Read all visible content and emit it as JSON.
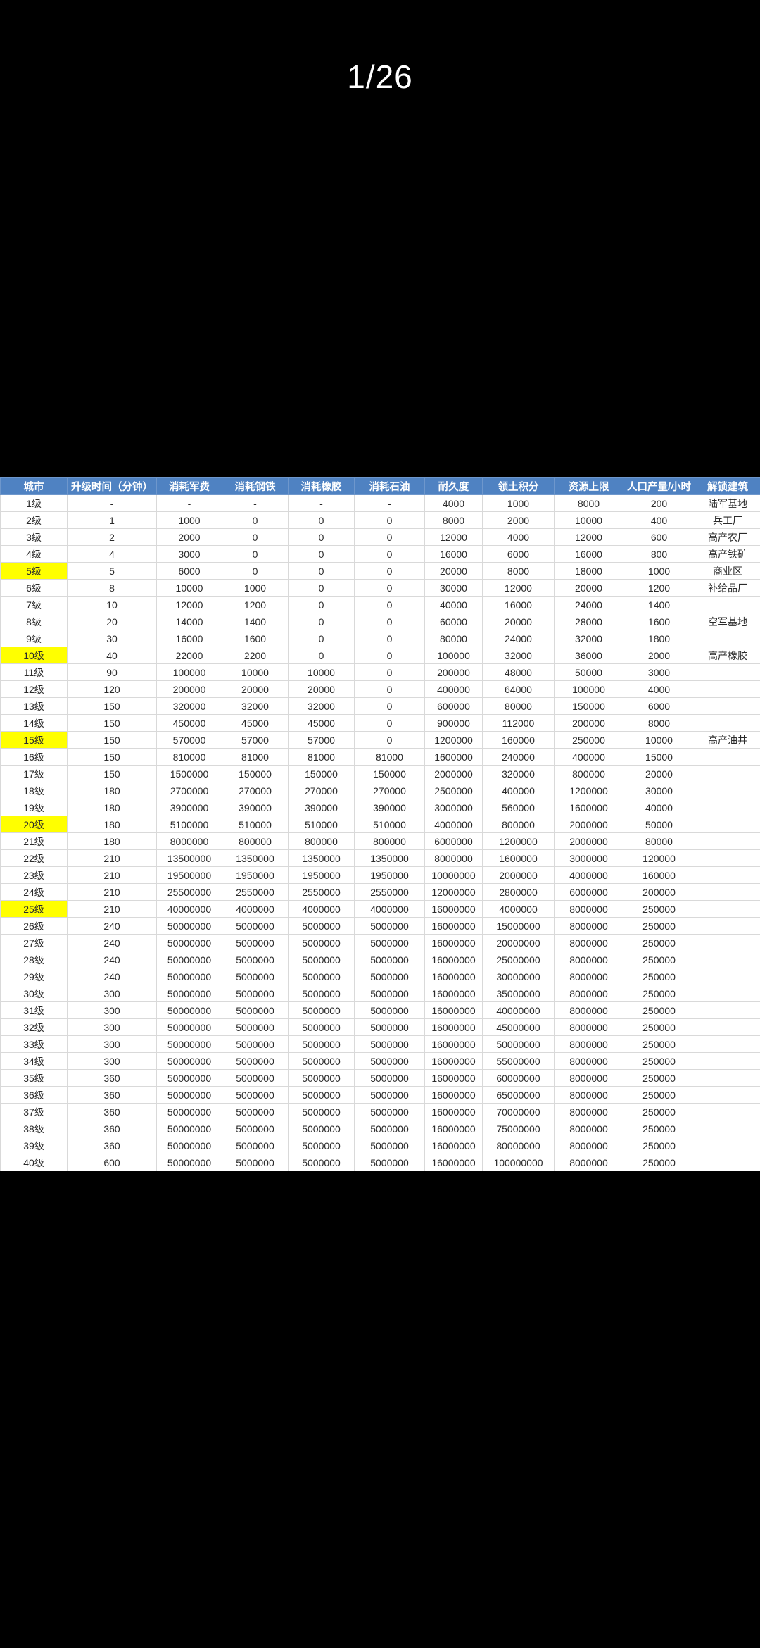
{
  "pager": {
    "label": "1/26"
  },
  "colors": {
    "screen_background": "#000000",
    "header_background": "#4f82c2",
    "header_text": "#ffffff",
    "highlight": "#ffff00",
    "cell_border": "#d9d9d9",
    "cell_text": "#2b2b2b"
  },
  "table": {
    "headers": [
      "城市",
      "升级时间（分钟）",
      "消耗军费",
      "消耗钢铁",
      "消耗橡胶",
      "消耗石油",
      "耐久度",
      "领土积分",
      "资源上限",
      "人口产量/小时",
      "解锁建筑"
    ],
    "highlight_levels": [
      "5级",
      "10级",
      "15级",
      "20级",
      "25级"
    ],
    "rows": [
      [
        "1级",
        "-",
        "-",
        "-",
        "-",
        "-",
        "4000",
        "1000",
        "8000",
        "200",
        "陆军基地"
      ],
      [
        "2级",
        "1",
        "1000",
        "0",
        "0",
        "0",
        "8000",
        "2000",
        "10000",
        "400",
        "兵工厂"
      ],
      [
        "3级",
        "2",
        "2000",
        "0",
        "0",
        "0",
        "12000",
        "4000",
        "12000",
        "600",
        "高产农厂"
      ],
      [
        "4级",
        "4",
        "3000",
        "0",
        "0",
        "0",
        "16000",
        "6000",
        "16000",
        "800",
        "高产铁矿"
      ],
      [
        "5级",
        "5",
        "6000",
        "0",
        "0",
        "0",
        "20000",
        "8000",
        "18000",
        "1000",
        "商业区"
      ],
      [
        "6级",
        "8",
        "10000",
        "1000",
        "0",
        "0",
        "30000",
        "12000",
        "20000",
        "1200",
        "补给品厂"
      ],
      [
        "7级",
        "10",
        "12000",
        "1200",
        "0",
        "0",
        "40000",
        "16000",
        "24000",
        "1400",
        ""
      ],
      [
        "8级",
        "20",
        "14000",
        "1400",
        "0",
        "0",
        "60000",
        "20000",
        "28000",
        "1600",
        "空军基地"
      ],
      [
        "9级",
        "30",
        "16000",
        "1600",
        "0",
        "0",
        "80000",
        "24000",
        "32000",
        "1800",
        ""
      ],
      [
        "10级",
        "40",
        "22000",
        "2200",
        "0",
        "0",
        "100000",
        "32000",
        "36000",
        "2000",
        "高产橡胶"
      ],
      [
        "11级",
        "90",
        "100000",
        "10000",
        "10000",
        "0",
        "200000",
        "48000",
        "50000",
        "3000",
        ""
      ],
      [
        "12级",
        "120",
        "200000",
        "20000",
        "20000",
        "0",
        "400000",
        "64000",
        "100000",
        "4000",
        ""
      ],
      [
        "13级",
        "150",
        "320000",
        "32000",
        "32000",
        "0",
        "600000",
        "80000",
        "150000",
        "6000",
        ""
      ],
      [
        "14级",
        "150",
        "450000",
        "45000",
        "45000",
        "0",
        "900000",
        "112000",
        "200000",
        "8000",
        ""
      ],
      [
        "15级",
        "150",
        "570000",
        "57000",
        "57000",
        "0",
        "1200000",
        "160000",
        "250000",
        "10000",
        "高产油井"
      ],
      [
        "16级",
        "150",
        "810000",
        "81000",
        "81000",
        "81000",
        "1600000",
        "240000",
        "400000",
        "15000",
        ""
      ],
      [
        "17级",
        "150",
        "1500000",
        "150000",
        "150000",
        "150000",
        "2000000",
        "320000",
        "800000",
        "20000",
        ""
      ],
      [
        "18级",
        "180",
        "2700000",
        "270000",
        "270000",
        "270000",
        "2500000",
        "400000",
        "1200000",
        "30000",
        ""
      ],
      [
        "19级",
        "180",
        "3900000",
        "390000",
        "390000",
        "390000",
        "3000000",
        "560000",
        "1600000",
        "40000",
        ""
      ],
      [
        "20级",
        "180",
        "5100000",
        "510000",
        "510000",
        "510000",
        "4000000",
        "800000",
        "2000000",
        "50000",
        ""
      ],
      [
        "21级",
        "180",
        "8000000",
        "800000",
        "800000",
        "800000",
        "6000000",
        "1200000",
        "2000000",
        "80000",
        ""
      ],
      [
        "22级",
        "210",
        "13500000",
        "1350000",
        "1350000",
        "1350000",
        "8000000",
        "1600000",
        "3000000",
        "120000",
        ""
      ],
      [
        "23级",
        "210",
        "19500000",
        "1950000",
        "1950000",
        "1950000",
        "10000000",
        "2000000",
        "4000000",
        "160000",
        ""
      ],
      [
        "24级",
        "210",
        "25500000",
        "2550000",
        "2550000",
        "2550000",
        "12000000",
        "2800000",
        "6000000",
        "200000",
        ""
      ],
      [
        "25级",
        "210",
        "40000000",
        "4000000",
        "4000000",
        "4000000",
        "16000000",
        "4000000",
        "8000000",
        "250000",
        ""
      ],
      [
        "26级",
        "240",
        "50000000",
        "5000000",
        "5000000",
        "5000000",
        "16000000",
        "15000000",
        "8000000",
        "250000",
        ""
      ],
      [
        "27级",
        "240",
        "50000000",
        "5000000",
        "5000000",
        "5000000",
        "16000000",
        "20000000",
        "8000000",
        "250000",
        ""
      ],
      [
        "28级",
        "240",
        "50000000",
        "5000000",
        "5000000",
        "5000000",
        "16000000",
        "25000000",
        "8000000",
        "250000",
        ""
      ],
      [
        "29级",
        "240",
        "50000000",
        "5000000",
        "5000000",
        "5000000",
        "16000000",
        "30000000",
        "8000000",
        "250000",
        ""
      ],
      [
        "30级",
        "300",
        "50000000",
        "5000000",
        "5000000",
        "5000000",
        "16000000",
        "35000000",
        "8000000",
        "250000",
        ""
      ],
      [
        "31级",
        "300",
        "50000000",
        "5000000",
        "5000000",
        "5000000",
        "16000000",
        "40000000",
        "8000000",
        "250000",
        ""
      ],
      [
        "32级",
        "300",
        "50000000",
        "5000000",
        "5000000",
        "5000000",
        "16000000",
        "45000000",
        "8000000",
        "250000",
        ""
      ],
      [
        "33级",
        "300",
        "50000000",
        "5000000",
        "5000000",
        "5000000",
        "16000000",
        "50000000",
        "8000000",
        "250000",
        ""
      ],
      [
        "34级",
        "300",
        "50000000",
        "5000000",
        "5000000",
        "5000000",
        "16000000",
        "55000000",
        "8000000",
        "250000",
        ""
      ],
      [
        "35级",
        "360",
        "50000000",
        "5000000",
        "5000000",
        "5000000",
        "16000000",
        "60000000",
        "8000000",
        "250000",
        ""
      ],
      [
        "36级",
        "360",
        "50000000",
        "5000000",
        "5000000",
        "5000000",
        "16000000",
        "65000000",
        "8000000",
        "250000",
        ""
      ],
      [
        "37级",
        "360",
        "50000000",
        "5000000",
        "5000000",
        "5000000",
        "16000000",
        "70000000",
        "8000000",
        "250000",
        ""
      ],
      [
        "38级",
        "360",
        "50000000",
        "5000000",
        "5000000",
        "5000000",
        "16000000",
        "75000000",
        "8000000",
        "250000",
        ""
      ],
      [
        "39级",
        "360",
        "50000000",
        "5000000",
        "5000000",
        "5000000",
        "16000000",
        "80000000",
        "8000000",
        "250000",
        ""
      ],
      [
        "40级",
        "600",
        "50000000",
        "5000000",
        "5000000",
        "5000000",
        "16000000",
        "100000000",
        "8000000",
        "250000",
        ""
      ]
    ]
  }
}
